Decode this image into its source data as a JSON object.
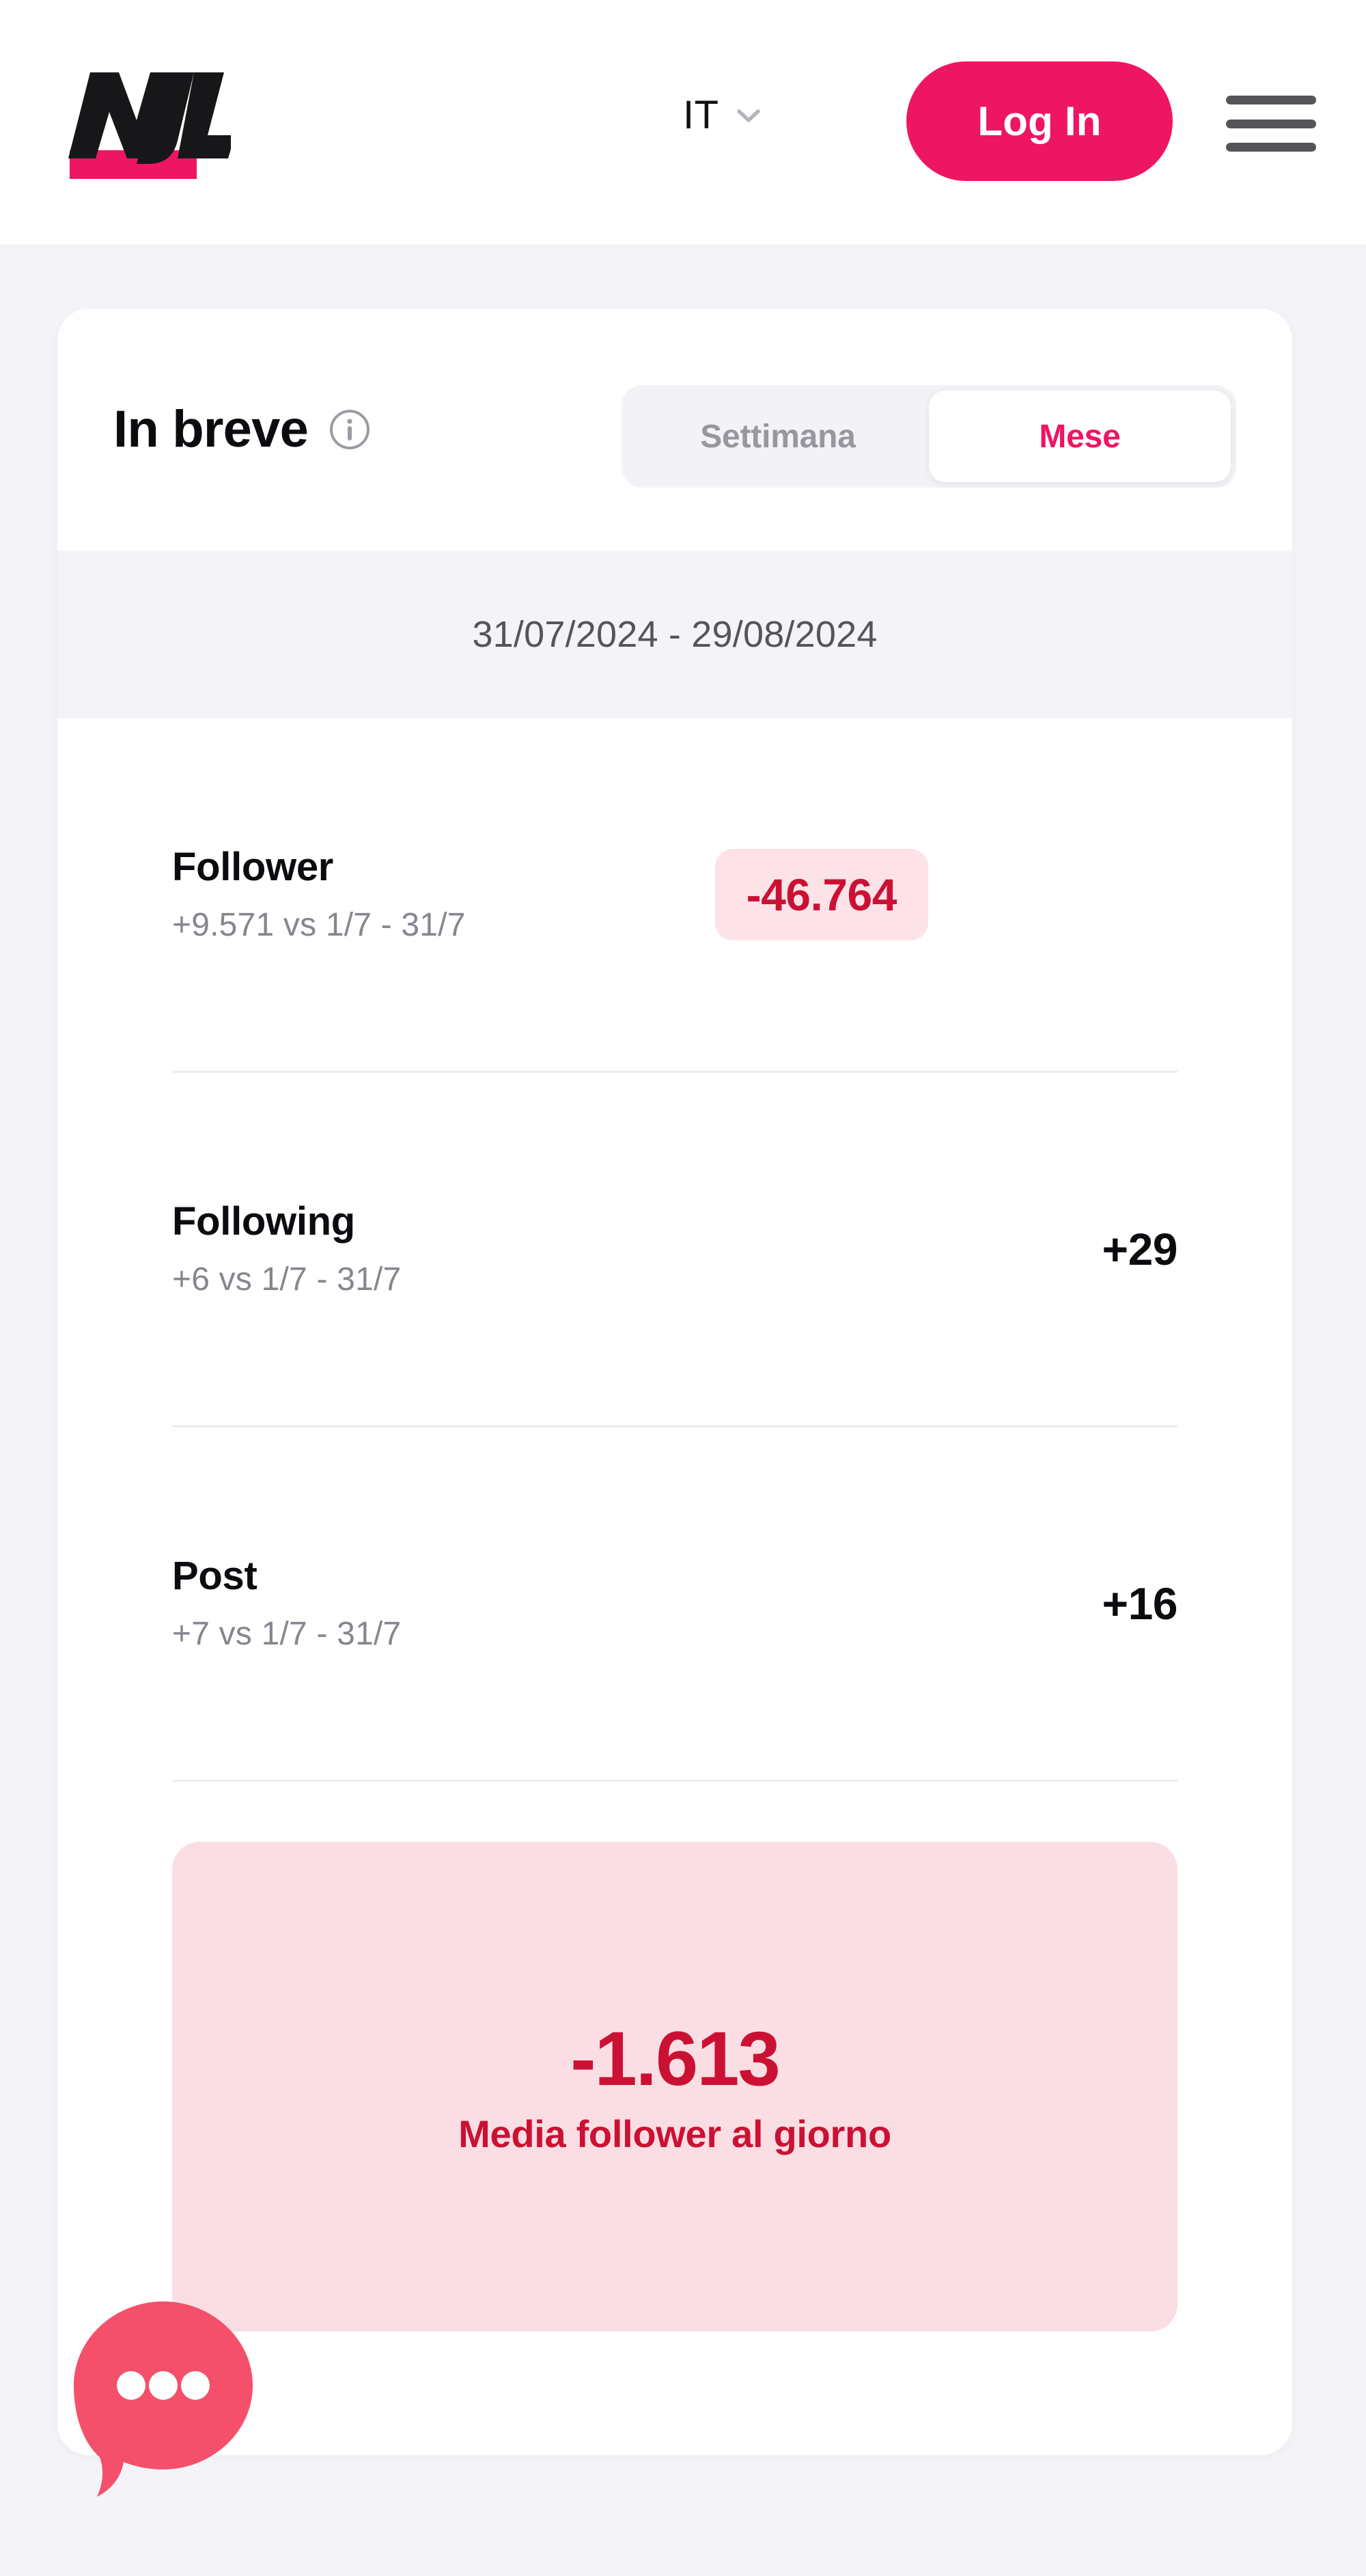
{
  "header": {
    "logo_text": "NJL",
    "logo_icon": "njl-logo",
    "language": {
      "label": "IT",
      "chevron_icon": "chevron-down-icon"
    },
    "login_label": "Log In",
    "menu_icon": "hamburger-menu-icon"
  },
  "card": {
    "title": "In breve",
    "info_icon": "info-circle-icon",
    "period_toggle": {
      "options": [
        "Settimana",
        "Mese"
      ],
      "selected": "Mese"
    },
    "date_range": "31/07/2024 - 29/08/2024",
    "metrics": [
      {
        "label": "Follower",
        "comparison": "+9.571 vs 1/7 - 31/7",
        "value": "-46.764",
        "style": "badge-negative"
      },
      {
        "label": "Following",
        "comparison": "+6 vs 1/7 - 31/7",
        "value": "+29",
        "style": "plain"
      },
      {
        "label": "Post",
        "comparison": "+7 vs 1/7 - 31/7",
        "value": "+16",
        "style": "plain"
      }
    ],
    "summary": {
      "value": "-1.613",
      "label": "Media follower al giorno"
    }
  },
  "chat": {
    "icon": "chat-bubble-ellipsis-icon"
  },
  "colors": {
    "brand_pink": "#ee1563",
    "negative_red": "#cb1133",
    "negative_bg": "#fde3e8",
    "summary_bg": "#fbdee4",
    "page_bg": "#f4f4f8",
    "chat_pink": "#f4506b"
  }
}
